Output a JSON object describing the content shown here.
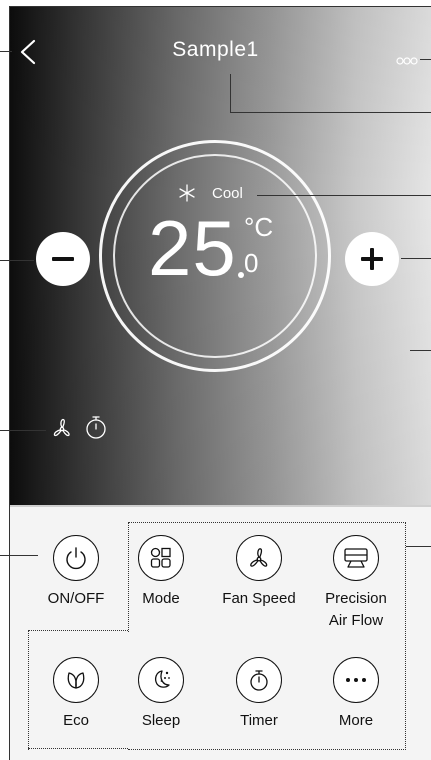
{
  "header": {
    "title": "Sample1",
    "back_icon": "chevron-left-icon",
    "more_icon": "three-dots-icon"
  },
  "status": {
    "mode_icon": "snowflake-icon",
    "mode_label": "Cool",
    "temperature": "25",
    "temperature_decimal": "0",
    "unit": "°C",
    "fan_icon": "fan-icon",
    "timer_icon": "timer-icon"
  },
  "adjust": {
    "decrease_label": "−",
    "increase_label": "+"
  },
  "controls": [
    {
      "label": "ON/OFF",
      "icon": "power-icon"
    },
    {
      "label": "Mode",
      "icon": "mode-grid-icon"
    },
    {
      "label": "Fan Speed",
      "icon": "fan-icon"
    },
    {
      "label": "Precision",
      "label2": "Air Flow",
      "icon": "air-conditioner-icon"
    },
    {
      "label": "Eco",
      "icon": "leaf-icon"
    },
    {
      "label": "Sleep",
      "icon": "moon-stars-icon"
    },
    {
      "label": "Timer",
      "icon": "timer-icon"
    },
    {
      "label": "More",
      "icon": "ellipsis-icon"
    }
  ],
  "colors": {
    "text_on_hero": "#ffffff",
    "button_stroke": "#111111",
    "panel_bg": "#f4f4f4"
  }
}
